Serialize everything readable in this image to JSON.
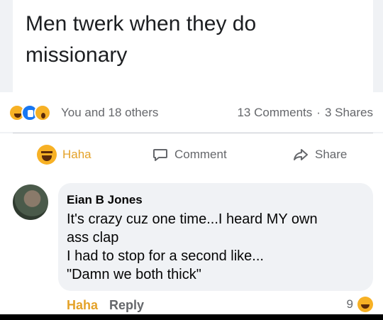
{
  "post": {
    "text": "Men twerk when they do missionary"
  },
  "reactions": {
    "icons": [
      "haha-icon",
      "like-icon",
      "wow-icon"
    ],
    "summary": "You and 18 others",
    "comments_count": "13 Comments",
    "separator": "·",
    "shares_count": "3 Shares"
  },
  "actions": {
    "haha_label": "Haha",
    "comment_label": "Comment",
    "share_label": "Share"
  },
  "comment": {
    "author": "Eian B Jones",
    "lines": [
      "It's crazy cuz one time...I heard MY own",
      "ass clap",
      "I had to stop for a second like...",
      "\"Damn we both thick\""
    ],
    "haha_label": "Haha",
    "reply_label": "Reply",
    "reaction_count": "9"
  },
  "colors": {
    "haha_accent": "#e4a229",
    "muted_text": "#65676b",
    "like_blue": "#1877f2"
  }
}
